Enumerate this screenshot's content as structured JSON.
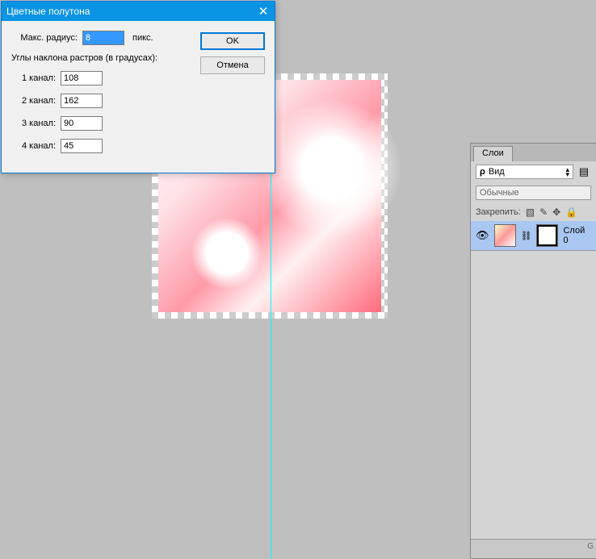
{
  "dialog": {
    "title": "Цветные полутона",
    "max_radius_label": "Макс. радиус:",
    "max_radius_value": "8",
    "unit": "пикс.",
    "angles_label": "Углы наклона растров (в градусах):",
    "channels": [
      {
        "label": "1 канал:",
        "value": "108"
      },
      {
        "label": "2 канал:",
        "value": "162"
      },
      {
        "label": "3 канал:",
        "value": "90"
      },
      {
        "label": "4 канал:",
        "value": "45"
      }
    ],
    "ok": "OK",
    "cancel": "Отмена"
  },
  "panel": {
    "tab": "Слои",
    "filter_prefix": "ρ",
    "filter": "Вид",
    "blend_mode": "Обычные",
    "lock_label": "Закрепить:",
    "layer_name": "Слой 0",
    "footer": "G"
  }
}
